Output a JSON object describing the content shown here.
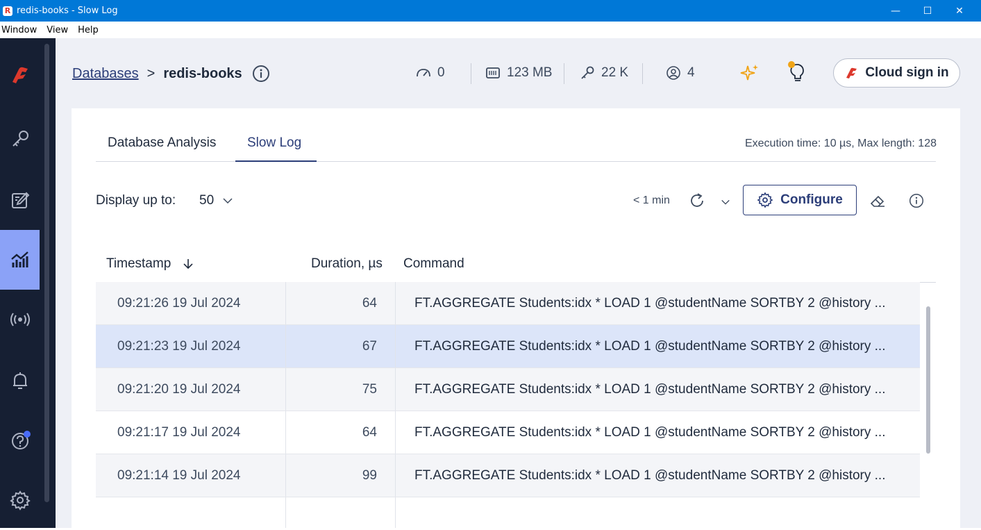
{
  "window": {
    "title": "redis-books - Slow Log",
    "app_icon_letter": "R",
    "controls": {
      "minimize": "—",
      "maximize": "☐",
      "close": "✕"
    }
  },
  "menu": {
    "items": [
      {
        "label": "Window"
      },
      {
        "label": "View"
      },
      {
        "label": "Help"
      }
    ]
  },
  "sidebar": {
    "items": [
      {
        "name": "logo",
        "icon": "redis-logo-icon"
      },
      {
        "name": "browser",
        "icon": "key-icon"
      },
      {
        "name": "workbench",
        "icon": "edit-icon"
      },
      {
        "name": "analytics",
        "icon": "analytics-icon",
        "active": true
      },
      {
        "name": "pubsub",
        "icon": "broadcast-icon"
      },
      {
        "name": "notifications",
        "icon": "bell-icon"
      },
      {
        "name": "help",
        "icon": "help-icon",
        "badge": true
      },
      {
        "name": "settings",
        "icon": "gear-icon"
      }
    ],
    "accent_color": "#8ba2f7"
  },
  "header": {
    "breadcrumb_link": "Databases",
    "breadcrumb_sep": ">",
    "database_name": "redis-books",
    "stats": {
      "ops": "0",
      "memory": "123 MB",
      "keys": "22 K",
      "clients": "4"
    },
    "cloud_button": "Cloud sign in"
  },
  "tabs": [
    {
      "label": "Database Analysis",
      "active": false
    },
    {
      "label": "Slow Log",
      "active": true
    }
  ],
  "exec_info": "Execution time: 10 µs, Max length: 128",
  "toolbar": {
    "display_label": "Display up to:",
    "display_value": "50",
    "last_refresh": "< 1 min",
    "configure_label": "Configure"
  },
  "table": {
    "columns": {
      "timestamp": "Timestamp",
      "duration": "Duration, µs",
      "command": "Command"
    },
    "rows": [
      {
        "timestamp": "09:21:26 19 Jul 2024",
        "duration": "64",
        "command": "FT.AGGREGATE Students:idx * LOAD 1 @studentName SORTBY 2 @history ..."
      },
      {
        "timestamp": "09:21:23 19 Jul 2024",
        "duration": "67",
        "command": "FT.AGGREGATE Students:idx * LOAD 1 @studentName SORTBY 2 @history ..."
      },
      {
        "timestamp": "09:21:20 19 Jul 2024",
        "duration": "75",
        "command": "FT.AGGREGATE Students:idx * LOAD 1 @studentName SORTBY 2 @history ..."
      },
      {
        "timestamp": "09:21:17 19 Jul 2024",
        "duration": "64",
        "command": "FT.AGGREGATE Students:idx * LOAD 1 @studentName SORTBY 2 @history ..."
      },
      {
        "timestamp": "09:21:14 19 Jul 2024",
        "duration": "99",
        "command": "FT.AGGREGATE Students:idx * LOAD 1 @studentName SORTBY 2 @history ..."
      }
    ],
    "selected_row": 1
  },
  "colors": {
    "brand_red": "#dc382c",
    "nav_bg": "#161f33",
    "primary": "#2c3e79",
    "selected_row": "#dce5f9"
  }
}
